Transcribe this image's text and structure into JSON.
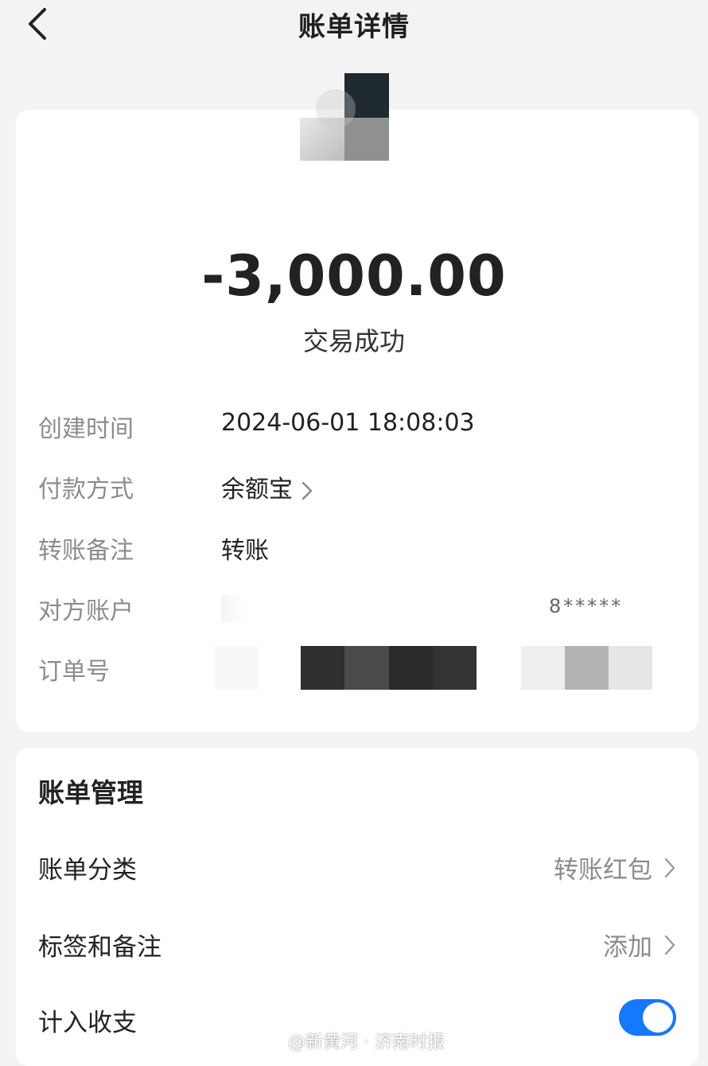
{
  "header": {
    "title": "账单详情"
  },
  "transaction": {
    "amount": "-3,000.00",
    "status": "交易成功"
  },
  "details": [
    {
      "label": "创建时间",
      "value": "2024-06-01 18:08:03"
    },
    {
      "label": "付款方式",
      "value": "余额宝"
    },
    {
      "label": "转账备注",
      "value": "转账"
    },
    {
      "label": "对方账户",
      "value": "8*****"
    },
    {
      "label": "订单号",
      "value": ""
    }
  ],
  "management": {
    "title": "账单管理",
    "category": {
      "label": "账单分类",
      "value": "转账红包"
    },
    "tags": {
      "label": "标签和备注",
      "value": "添加"
    },
    "include": {
      "label": "计入收支",
      "enabled": true
    }
  },
  "watermark": {
    "text": "@新黄河 · 济南时报"
  },
  "colors": {
    "accent": "#1677ff",
    "background": "#f3f3f3"
  },
  "icons": [
    "back-arrow-icon",
    "chevron-right-icon",
    "weibo-icon"
  ]
}
